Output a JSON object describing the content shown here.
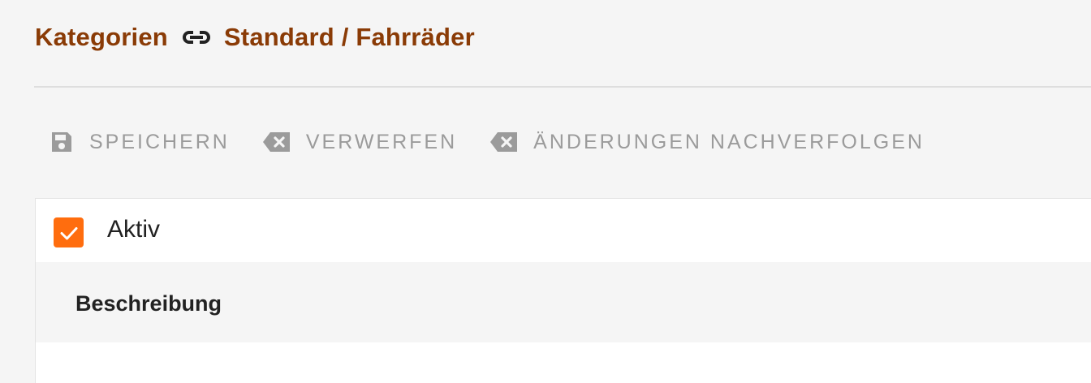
{
  "header": {
    "category_label": "Kategorien",
    "path": "Standard / Fahrräder",
    "link_icon": "link-icon",
    "color": "#8a3b06"
  },
  "toolbar": {
    "save_label": "SPEICHERN",
    "discard_label": "VERWERFEN",
    "track_changes_label": "ÄNDERUNGEN NACHVERFOLGEN",
    "save_icon": "floppy-disk-icon",
    "discard_icon": "backspace-icon",
    "track_changes_icon": "backspace-icon",
    "color": "#9b9b9b"
  },
  "form": {
    "active_label": "Aktiv",
    "active_checked": true,
    "checkbox_color": "#ff6d0e",
    "description_title": "Beschreibung"
  }
}
